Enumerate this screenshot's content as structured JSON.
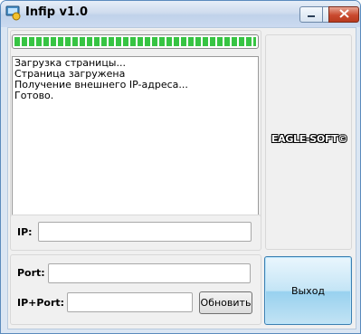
{
  "window": {
    "title": "Infip v1.0"
  },
  "progress": {
    "value_percent": 100,
    "color": "#37c443"
  },
  "log": {
    "lines": [
      "Загрузка страницы...",
      "Страница загружена",
      "Получение внешнего IP-адреса...",
      "Готово."
    ]
  },
  "fields": {
    "ip_label": "IP:",
    "ip_value": "",
    "port_label": "Port:",
    "port_value": "",
    "ipport_label": "IP+Port:",
    "ipport_value": ""
  },
  "buttons": {
    "refresh": "Обновить",
    "exit": "Выход"
  },
  "brand": "EAGLE-SOFT©",
  "icons": {
    "app": "app-icon",
    "minimize": "minimize-icon",
    "maximize": "maximize-icon",
    "close": "close-icon"
  }
}
